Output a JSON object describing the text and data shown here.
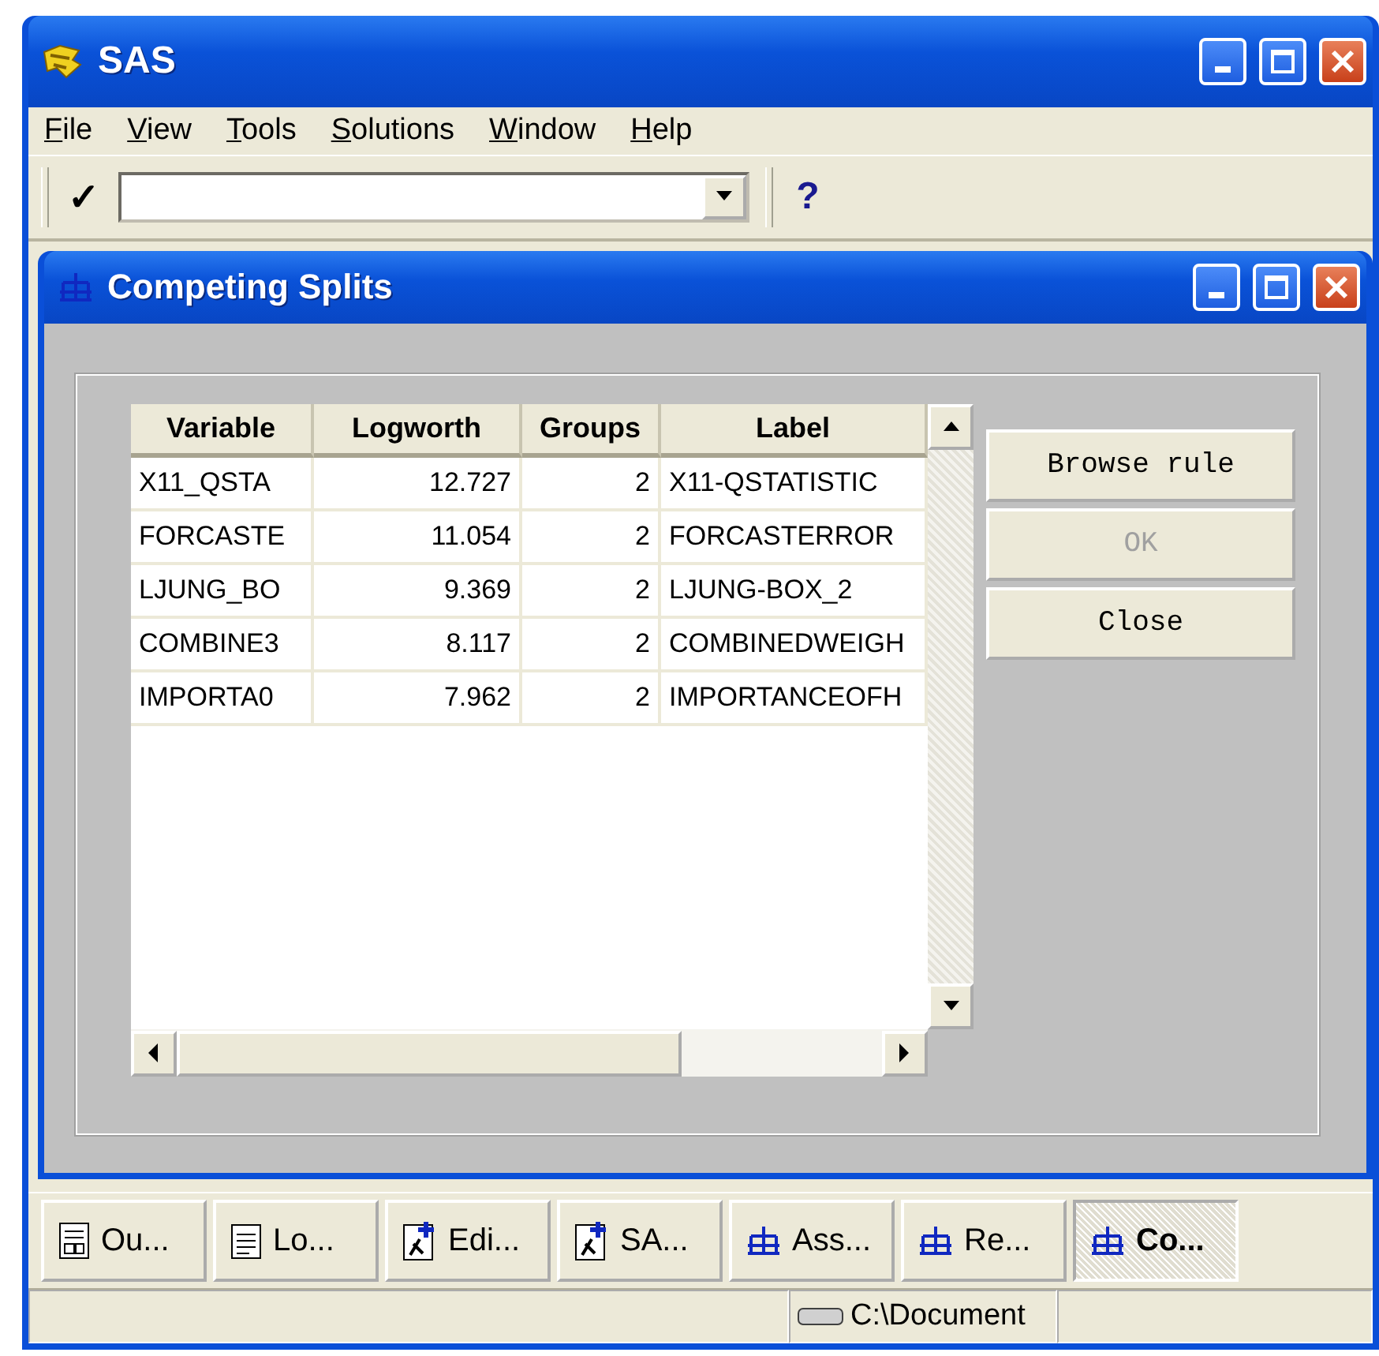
{
  "window": {
    "title": "SAS"
  },
  "menu": [
    "File",
    "View",
    "Tools",
    "Solutions",
    "Window",
    "Help"
  ],
  "toolbar": {
    "check": "✓",
    "help": "?"
  },
  "dialog": {
    "title": "Competing Splits",
    "table": {
      "columns": [
        {
          "label": "Variable",
          "kind": "text"
        },
        {
          "label": "Logworth",
          "kind": "number"
        },
        {
          "label": "Groups",
          "kind": "number"
        },
        {
          "label": "Label",
          "kind": "text"
        }
      ],
      "rows": [
        [
          "X11_QSTA",
          "12.727",
          "2",
          "X11-QSTATISTIC"
        ],
        [
          "FORCASTE",
          "11.054",
          "2",
          "FORCASTERROR"
        ],
        [
          "LJUNG_BO",
          "9.369",
          "2",
          "LJUNG-BOX_2"
        ],
        [
          "COMBINE3",
          "8.117",
          "2",
          "COMBINEDWEIGH"
        ],
        [
          "IMPORTA0",
          "7.962",
          "2",
          "IMPORTANCEOFH"
        ]
      ]
    },
    "buttons": [
      {
        "label": "Browse rule",
        "disabled": false
      },
      {
        "label": "OK",
        "disabled": true
      },
      {
        "label": "Close",
        "disabled": false
      }
    ]
  },
  "taskbar": [
    {
      "label": "Ou...",
      "kind": "output",
      "selected": false
    },
    {
      "label": "Lo...",
      "kind": "log",
      "selected": false
    },
    {
      "label": "Edi...",
      "kind": "editor",
      "selected": false
    },
    {
      "label": "SA...",
      "kind": "editor",
      "selected": false
    },
    {
      "label": "Ass...",
      "kind": "tree",
      "selected": false
    },
    {
      "label": "Re...",
      "kind": "tree",
      "selected": false
    },
    {
      "label": "Co...",
      "kind": "tree",
      "selected": true
    }
  ],
  "status_bar": {
    "path": "C:\\Document"
  }
}
